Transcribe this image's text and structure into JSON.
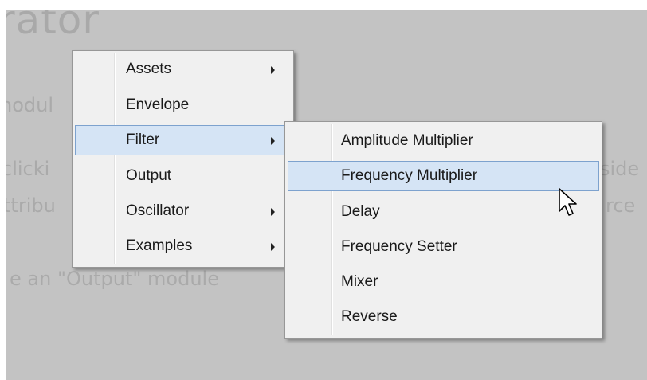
{
  "background": {
    "title": "rator",
    "lines": [
      "nodul",
      "clicki",
      "ttribu",
      "e an \"Output\" module",
      "side",
      "rce"
    ]
  },
  "main_menu": {
    "items": [
      {
        "label": "Assets",
        "has_submenu": true
      },
      {
        "label": "Envelope",
        "has_submenu": false
      },
      {
        "label": "Filter",
        "has_submenu": true,
        "highlighted": true
      },
      {
        "label": "Output",
        "has_submenu": false
      },
      {
        "label": "Oscillator",
        "has_submenu": true
      },
      {
        "label": "Examples",
        "has_submenu": true
      }
    ]
  },
  "filter_submenu": {
    "items": [
      {
        "label": "Amplitude Multiplier"
      },
      {
        "label": "Frequency Multiplier",
        "highlighted": true
      },
      {
        "label": "Delay"
      },
      {
        "label": "Frequency Setter"
      },
      {
        "label": "Mixer"
      },
      {
        "label": "Reverse"
      }
    ]
  },
  "colors": {
    "canvas": "#c3c3c3",
    "menu_bg": "#f0f0f0",
    "highlight_bg": "#d5e4f5",
    "highlight_border": "#7da2ce"
  },
  "icons": {
    "cursor": "mouse-pointer-icon",
    "submenu": "submenu-arrow-icon"
  }
}
